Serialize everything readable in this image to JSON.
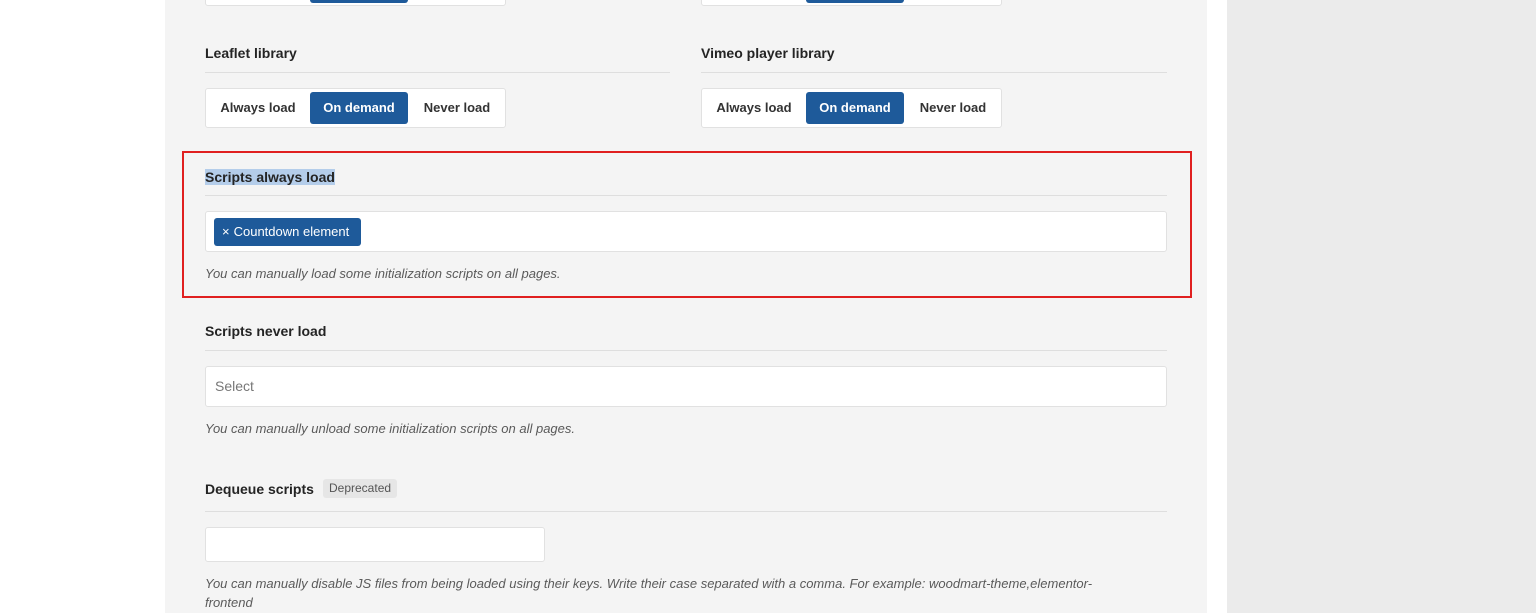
{
  "leaflet": {
    "title": "Leaflet library",
    "options": [
      "Always load",
      "On demand",
      "Never load"
    ],
    "selected": "On demand"
  },
  "vimeo": {
    "title": "Vimeo player library",
    "options": [
      "Always load",
      "On demand",
      "Never load"
    ],
    "selected": "On demand"
  },
  "scripts_always": {
    "title": "Scripts always load",
    "tags": [
      {
        "remove": "×",
        "label": "Countdown element"
      }
    ],
    "hint": "You can manually load some initialization scripts on all pages."
  },
  "scripts_never": {
    "title": "Scripts never load",
    "placeholder": "Select",
    "hint": "You can manually unload some initialization scripts on all pages."
  },
  "dequeue": {
    "title": "Dequeue scripts",
    "badge": "Deprecated",
    "value": "",
    "hint_line1": "You can manually disable JS files from being loaded using their keys. Write their case separated with a comma. For example: woodmart-theme,elementor-",
    "hint_line2": "frontend"
  },
  "colors": {
    "accent": "#1e5a9a",
    "highlight_border": "#e02020",
    "panel_bg": "#f4f4f4",
    "sidebar_bg": "#ebebeb"
  }
}
